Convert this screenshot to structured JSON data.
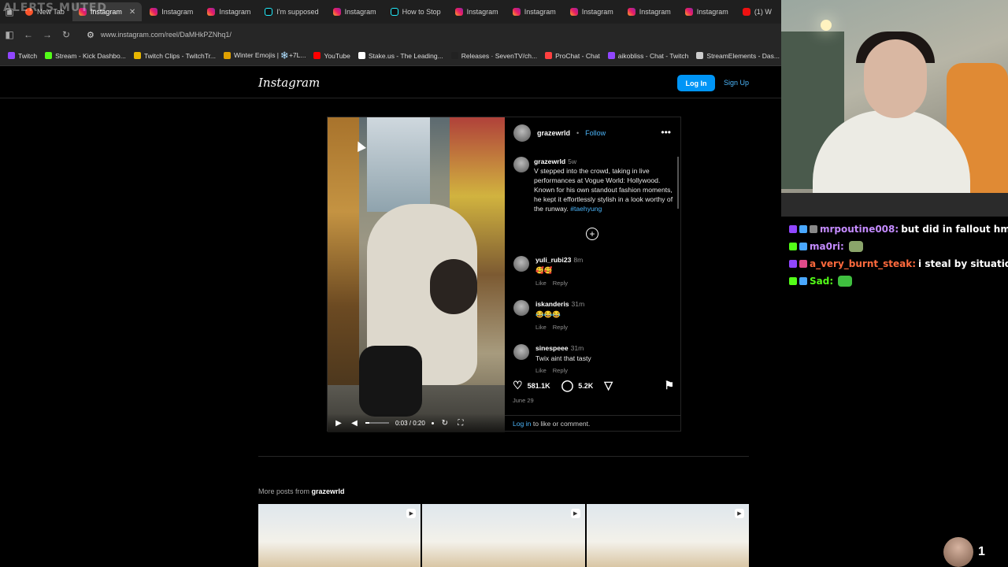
{
  "browser": {
    "overlay_text": "ALERTS MUTED",
    "tabs": [
      {
        "label": "New Tab",
        "icon": "brave-icon",
        "active": false
      },
      {
        "label": "Instagram",
        "icon": "instagram-icon",
        "active": true
      },
      {
        "label": "Instagram",
        "icon": "instagram-icon",
        "active": false
      },
      {
        "label": "Instagram",
        "icon": "instagram-icon",
        "active": false
      },
      {
        "label": "I'm supposed",
        "icon": "tiktok-icon",
        "active": false
      },
      {
        "label": "Instagram",
        "icon": "instagram-icon",
        "active": false
      },
      {
        "label": "How to Stop",
        "icon": "tiktok-icon",
        "active": false
      },
      {
        "label": "Instagram",
        "icon": "instagram-icon",
        "active": false
      },
      {
        "label": "Instagram",
        "icon": "instagram-icon",
        "active": false
      },
      {
        "label": "Instagram",
        "icon": "instagram-icon",
        "active": false
      },
      {
        "label": "Instagram",
        "icon": "instagram-icon",
        "active": false
      },
      {
        "label": "Instagram",
        "icon": "instagram-icon",
        "active": false
      },
      {
        "label": "(1) W",
        "icon": "youtube-icon",
        "active": false
      }
    ],
    "url": "www.instagram.com/reel/DaMHkPZNhq1/",
    "bookmarks": [
      {
        "label": "Twitch",
        "color": "#9146ff"
      },
      {
        "label": "Stream - Kick Dashbo...",
        "color": "#53fc18"
      },
      {
        "label": "Twitch Clips - TwitchTr...",
        "color": "#e8b600"
      },
      {
        "label": "Winter Emojis | ❄️+7L...",
        "color": "#e0a000"
      },
      {
        "label": "YouTube",
        "color": "#ff0000"
      },
      {
        "label": "Stake.us - The Leading...",
        "color": "#ffffff"
      },
      {
        "label": "Releases · SevenTV/ch...",
        "color": "#222222"
      },
      {
        "label": "ProChat - Chat",
        "color": "#ff4040"
      },
      {
        "label": "aikobliss - Chat - Twitch",
        "color": "#9146ff"
      },
      {
        "label": "StreamElements - Das...",
        "color": "#cccccc"
      }
    ]
  },
  "instagram": {
    "logo": "Instagram",
    "login_label": "Log In",
    "signup_label": "Sign Up",
    "post": {
      "username": "grazewrld",
      "separator": "•",
      "follow_label": "Follow",
      "caption": {
        "username": "grazewrld",
        "time": "5w",
        "text": "V stepped into the crowd, taking in live performances at Vogue World: Hollywood. Known for his own standout fashion moments, he kept it effortlessly stylish in a look worthy of the runway.",
        "hashtag": "#taehyung"
      },
      "comments": [
        {
          "username": "yuli_rubi23",
          "time": "8m",
          "text": "🥰🥰",
          "like": "Like",
          "reply": "Reply"
        },
        {
          "username": "iskanderis",
          "time": "31m",
          "text": "😂😂😂",
          "like": "Like",
          "reply": "Reply"
        },
        {
          "username": "sinespeee",
          "time": "31m",
          "text": "Twix aint that tasty",
          "like": "Like",
          "reply": "Reply"
        }
      ],
      "likes": "581.1K",
      "comment_count": "5.2K",
      "date": "June 29",
      "login_prompt_link": "Log in",
      "login_prompt_text": "to like or comment.",
      "video": {
        "time": "0:03 / 0:20",
        "progress": 0.15
      }
    },
    "more_posts_prefix": "More posts from",
    "more_posts_user": "grazewrld"
  },
  "stream": {
    "chat": [
      {
        "user": "mrpoutine008:",
        "user_color": "#c48bff",
        "text": "but did in fallout hmm",
        "badges": [
          "#9146ff",
          "#4aa8ff",
          "#888888"
        ]
      },
      {
        "user": "ma0ri:",
        "user_color": "#c48bff",
        "text": "",
        "badges": [
          "#53fc18",
          "#4aa8ff"
        ],
        "emote": "#8aa46a"
      },
      {
        "user": "a_very_burnt_steak:",
        "user_color": "#ff6a3d",
        "text": "i steal by situation",
        "badges": [
          "#9146ff",
          "#e04a8a"
        ]
      },
      {
        "user": "Sad:",
        "user_color": "#53fc18",
        "text": "",
        "badges": [
          "#53fc18",
          "#4aa8ff"
        ],
        "emote": "#3fbf3f"
      }
    ],
    "viewer_count": "1"
  }
}
